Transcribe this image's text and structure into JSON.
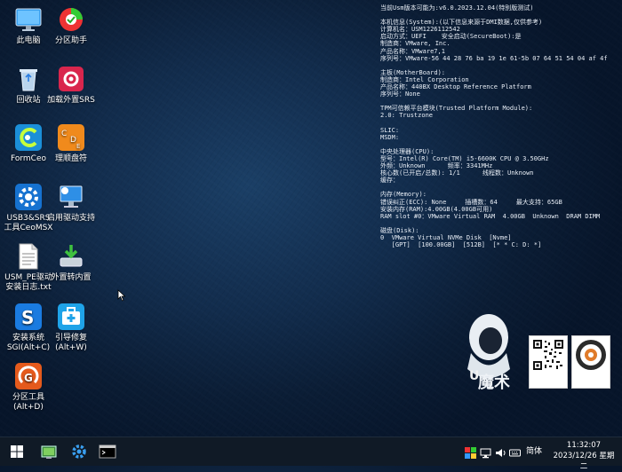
{
  "desktop_icons": [
    {
      "label": "此电脑",
      "icon": "monitor-icon"
    },
    {
      "label": "分区助手",
      "icon": "partition-assistant-icon"
    },
    {
      "label": "回收站",
      "icon": "recycle-bin-icon"
    },
    {
      "label": "加载外置SRS",
      "icon": "load-srs-icon"
    },
    {
      "label": "FormCeo",
      "icon": "formceo-icon"
    },
    {
      "label": "理顺盘符",
      "icon": "drive-letters-icon"
    },
    {
      "label": "USB3&SRS\n工具CeoMSX",
      "icon": "usb-srs-gear-icon"
    },
    {
      "label": "启用驱动支持",
      "icon": "driver-support-icon"
    },
    {
      "label": "USM_PE驱动\n安装日志.txt",
      "icon": "text-file-icon"
    },
    {
      "label": "外置转内置",
      "icon": "external-to-internal-icon"
    },
    {
      "label": "安装系统\nSGI(Alt+C)",
      "icon": "install-system-icon"
    },
    {
      "label": "引导修复\n(Alt+W)",
      "icon": "boot-repair-icon"
    },
    {
      "label": "分区工具\n(Alt+D)",
      "icon": "partition-tool-icon"
    }
  ],
  "system_info": [
    "当前Usm版本可能为:v6.0.2023.12.04(特别版测试)",
    "",
    "本机信息(System):(以下信息来源于DMI数据,仅供参考)",
    "计算机名：USM1226112542",
    "启动方式：UEFI    安全启动(SecureBoot):是",
    "制造商：VMware, Inc.",
    "产品名称：VMware7,1",
    "序列号：VMware-56 44 28 76 ba 19 1e 61-5b 07 64 51 54 04 af 4f",
    "",
    "主板(MotherBoard):",
    "制造商：Intel Corporation",
    "产品名称：440BX Desktop Reference Platform",
    "序列号：None",
    "",
    "TPM可信赖平台模块(Trusted Platform Module):",
    "2.0: Trustzone",
    "",
    "SLIC:",
    "MSDM:",
    "",
    "中央处理器(CPU):",
    "型号：Intel(R) Core(TM) i5-6600K CPU @ 3.50GHz",
    "外频：Unknown      频率：3341MHz",
    "核心数(已开启/总数): 1/1      线程数：Unknown",
    "缓存：",
    "",
    "内存(Memory):",
    "错误纠正(ECC): None     插槽数：64     最大支持：65GB",
    "安装内存(RAM):4.00GB(4.00GB可用)",
    "RAM slot #0：VMware Virtual RAM  4.00GB  Unknown  DRAM DIMM",
    "",
    "磁盘(Disk):",
    "0  VMware Virtual NVMe Disk  [Nvme]",
    "   [GPT]  [100.00GB]  [512B]  [* * C: D: *]"
  ],
  "taskbar": {
    "ime": "简体",
    "time": "11:32:07",
    "date": "2023/12/26 星期二"
  },
  "colors": {
    "taskbar": "#101a26",
    "desktop": "#122c4c",
    "accent": "#1e7fd6"
  }
}
